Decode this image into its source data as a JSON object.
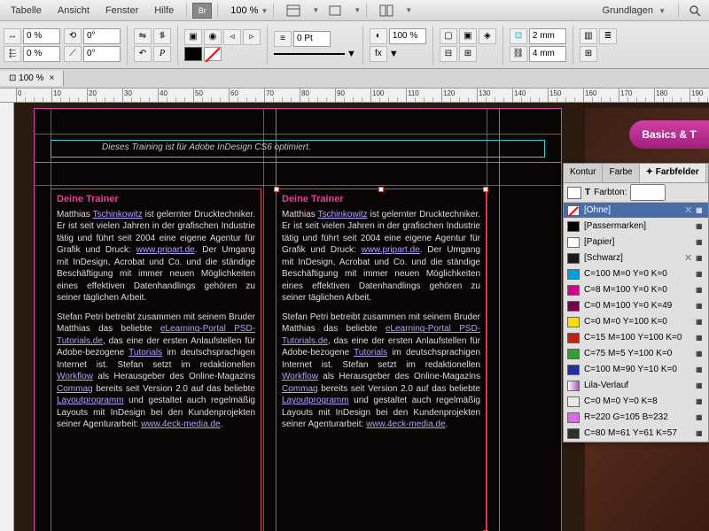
{
  "menu": {
    "items": [
      "Tabelle",
      "Ansicht",
      "Fenster",
      "Hilfe"
    ],
    "br": "Br",
    "zoom": "100 %",
    "workspace": "Grundlagen"
  },
  "toolbar": {
    "pct1": "0 %",
    "deg1": "0°",
    "deg2": "0°",
    "pct2": "0 %",
    "pt": "0 Pt",
    "pct3": "100 %",
    "mm1": "2 mm",
    "mm2": "4 mm"
  },
  "doc_tab": {
    "label": "100 %"
  },
  "ruler_h": [
    0,
    10,
    20,
    30,
    40,
    50,
    60,
    70,
    80,
    90,
    100,
    110,
    120,
    130,
    140,
    150,
    160,
    170,
    180,
    190
  ],
  "banner": "Dieses Training ist für Adobe InDesign CS6 optimiert.",
  "right_badge": "Basics & T",
  "frame": {
    "heading": "Deine Trainer",
    "p1a": "Matthias ",
    "p1b": "Tschinkowitz",
    "p1c": " ist gelernter Drucktechniker. Er ist seit vielen Jahren in der grafischen Industrie tätig und führt seit 2004 eine eigene Agentur für Grafik und Druck: ",
    "p1link": "www.pripart.de",
    "p1d": ". Der Umgang mit InDesign, Acrobat und Co. und die ständige Beschäftigung mit immer neuen Möglichkeiten eines effektiven Datenhandlings gehören zu seiner täglichen Arbeit.",
    "p2a": "Stefan Petri betreibt zusammen mit seinem Bruder Matthias das beliebte ",
    "p2link1": "eLearning-Portal PSD-Tutorials.de",
    "p2b": ", das eine der ersten Anlaufstellen für Adobe-bezogene ",
    "p2link2": "Tutorials",
    "p2c": " im deutschsprachigen Internet ist. Stefan setzt im redaktionellen ",
    "p2link3": "Workflow",
    "p2d": " als Herausgeber des Online-Magazins ",
    "p2link4": "Commag",
    "p2e": " bereits seit Version 2.0 auf das beliebte ",
    "p2link5": "Layoutprogramm",
    "p2f": " und gestaltet auch regelmäßig Layouts mit InDesign bei den Kundenprojekten seiner Agenturarbeit: ",
    "p2link6": "www.4eck-media.de",
    "p2g": "."
  },
  "panel": {
    "tabs": [
      "Kontur",
      "Farbe",
      "Farbfelder"
    ],
    "tint_label": "Farbton:",
    "swatches": [
      {
        "label": "[Ohne]",
        "type": "none",
        "locked": true,
        "selected": true
      },
      {
        "label": "[Passermarken]",
        "type": "reg",
        "color": "#000"
      },
      {
        "label": "[Papier]",
        "color": "#ffffff"
      },
      {
        "label": "[Schwarz]",
        "color": "#1a1a1a",
        "locked": true
      },
      {
        "label": "C=100 M=0 Y=0 K=0",
        "color": "#00a0e0"
      },
      {
        "label": "C=8 M=100 Y=0 K=0",
        "color": "#d6008b"
      },
      {
        "label": "C=0 M=100 Y=0 K=49",
        "color": "#7a004b"
      },
      {
        "label": "C=0 M=0 Y=100 K=0",
        "color": "#f5e000"
      },
      {
        "label": "C=15 M=100 Y=100 K=0",
        "color": "#c02010"
      },
      {
        "label": "C=75 M=5 Y=100 K=0",
        "color": "#30a030"
      },
      {
        "label": "C=100 M=90 Y=10 K=0",
        "color": "#2030a0"
      },
      {
        "label": "Lila-Verlauf",
        "color": "#a060c0",
        "grad": true
      },
      {
        "label": "C=0 M=0 Y=0 K=8",
        "color": "#e8e8e8"
      },
      {
        "label": "R=220 G=105 B=232",
        "color": "#dc69e8"
      },
      {
        "label": "C=80 M=61 Y=61 K=57",
        "color": "#2a3030"
      }
    ]
  }
}
